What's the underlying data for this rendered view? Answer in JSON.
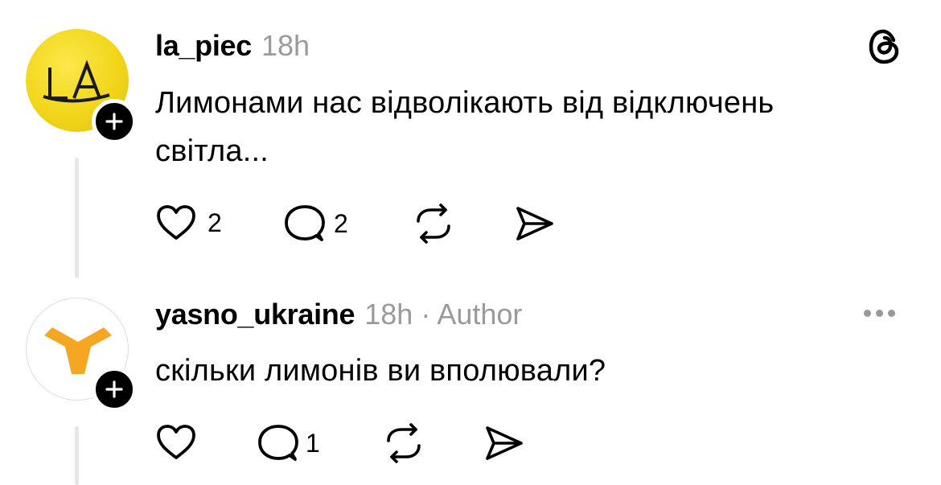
{
  "posts": [
    {
      "avatar_text": "LA",
      "username": "la_piec",
      "time": "18h",
      "text_line1": "Лимонами нас відволікають від відключень",
      "text_line2": "світла...",
      "likes": "2",
      "replies": "2",
      "top_right_icon": "threads-logo-icon",
      "accent": "#f2d61b"
    },
    {
      "username": "yasno_ukraine",
      "time": "18h",
      "separator": "·",
      "badge": "Author",
      "text": "скільки лимонів ви вполювали?",
      "likes": "",
      "replies": "1",
      "top_right_icon": "more-options-icon",
      "accent": "#f5a623"
    }
  ]
}
